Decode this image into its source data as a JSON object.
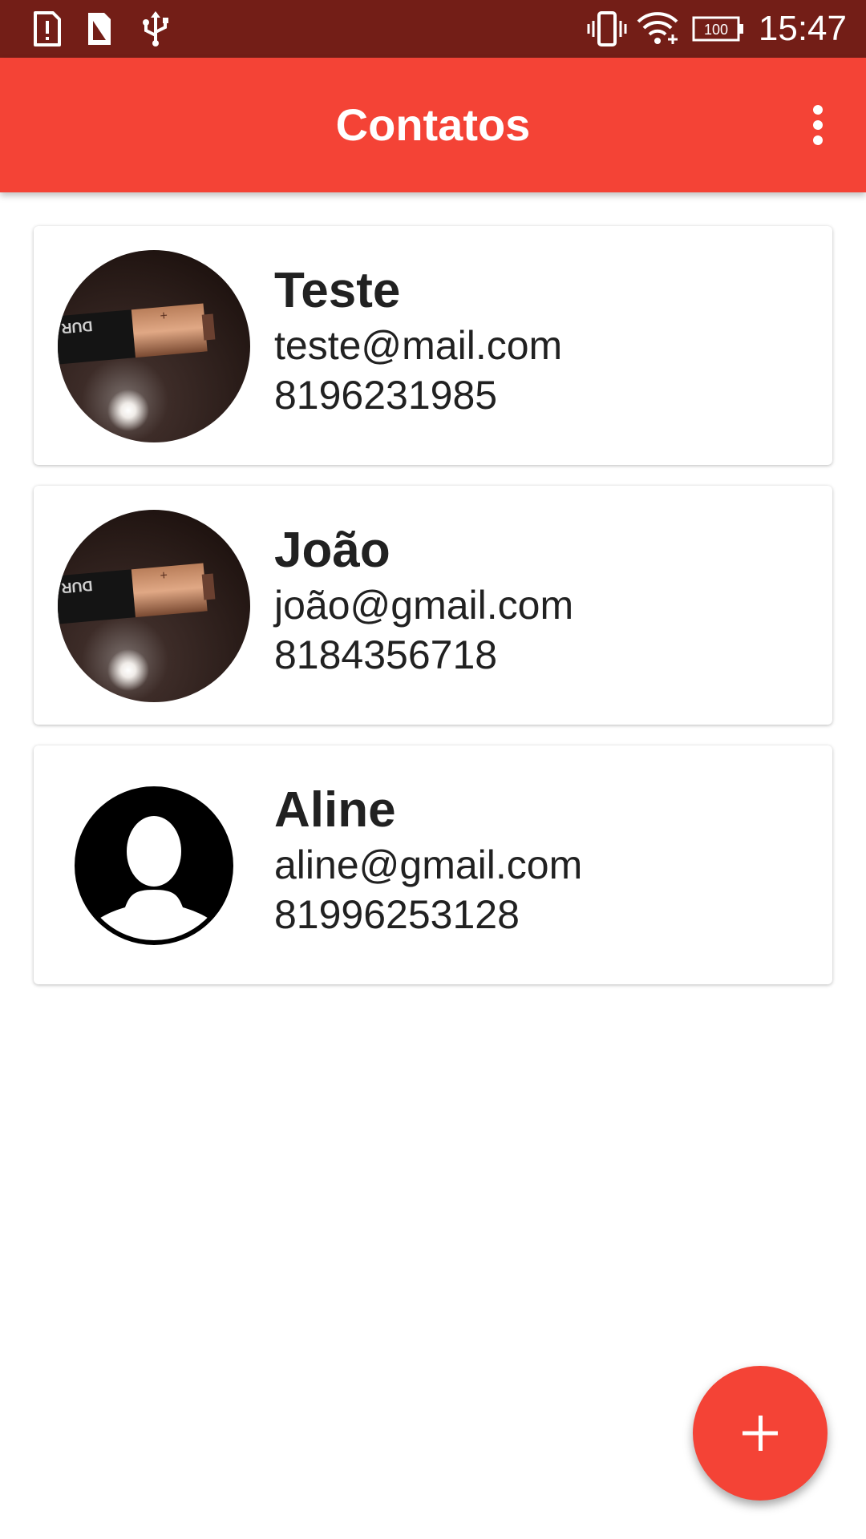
{
  "status_bar": {
    "time": "15:47",
    "battery_level": "100",
    "icons": [
      "alert-icon",
      "sim-icon",
      "usb-icon",
      "vibrate-icon",
      "wifi-icon",
      "battery-icon"
    ]
  },
  "app_bar": {
    "title": "Contatos",
    "menu_icon": "more-vert-icon"
  },
  "contacts": [
    {
      "name": "Teste",
      "email": "teste@mail.com",
      "phone": "8196231985",
      "avatar": "battery-photo"
    },
    {
      "name": "João",
      "email": "joão@gmail.com",
      "phone": "8184356718",
      "avatar": "battery-photo"
    },
    {
      "name": "Aline",
      "email": "aline@gmail.com",
      "phone": "81996253128",
      "avatar": "default-person-icon"
    }
  ],
  "fab": {
    "icon": "add-icon"
  },
  "colors": {
    "status_bar": "#731e17",
    "primary": "#f44336",
    "text": "#212121",
    "background": "#ffffff"
  }
}
